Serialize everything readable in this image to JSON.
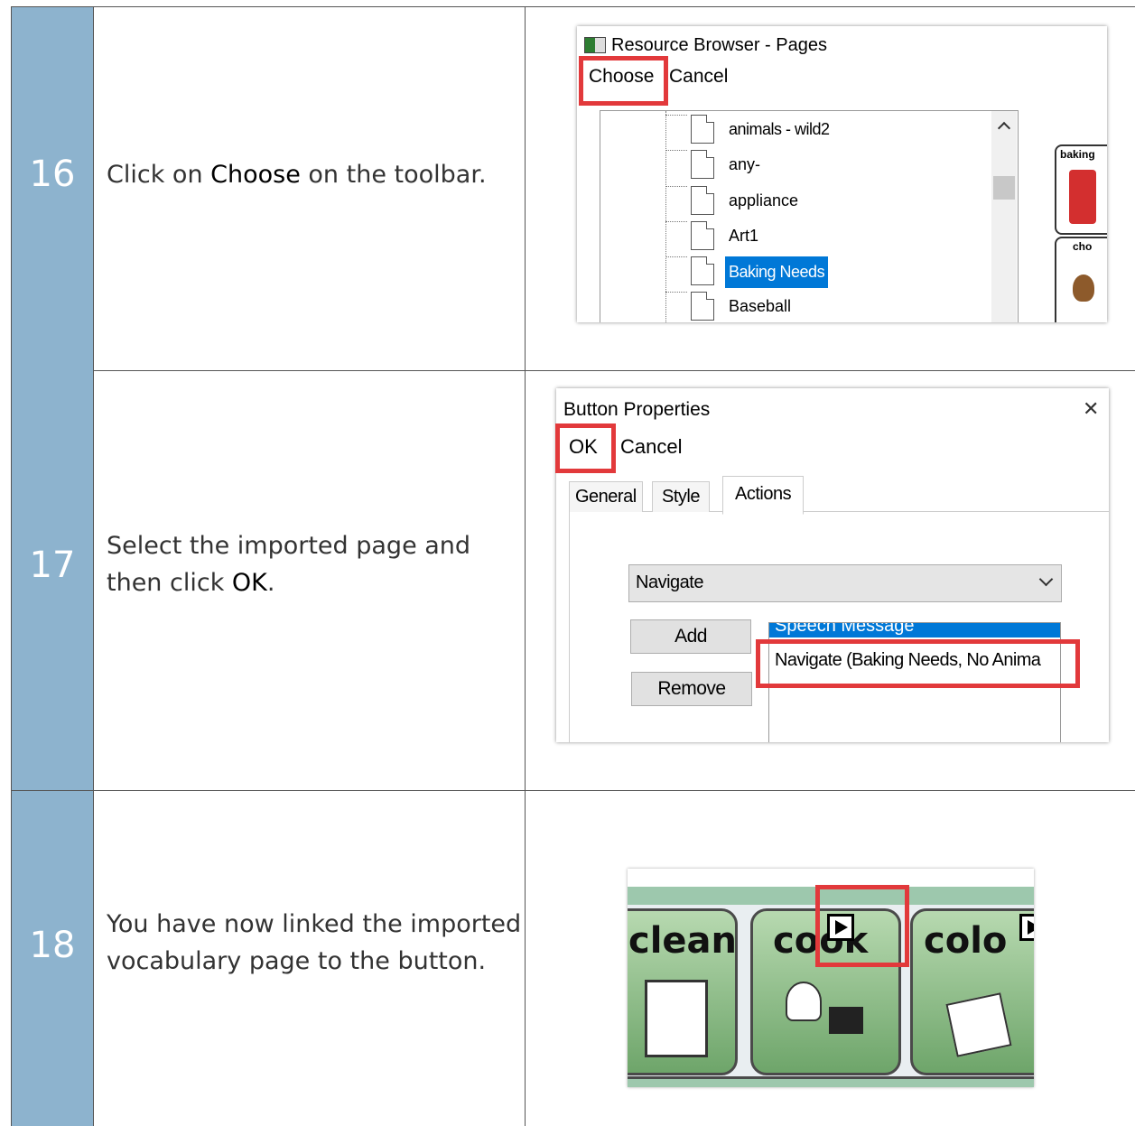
{
  "steps": [
    {
      "number": "16",
      "text_before": "Click on ",
      "text_bold": "Choose",
      "text_after": " on the toolbar."
    },
    {
      "number": "17",
      "text_before": "Select the imported page and then click ",
      "text_bold": "OK",
      "text_after": "."
    },
    {
      "number": "18",
      "text": "You have now linked the imported vocabulary page to the button."
    }
  ],
  "resource_browser": {
    "title": "Resource Browser - Pages",
    "toolbar": [
      "Choose",
      "Cancel"
    ],
    "pages": [
      "animals - wild2",
      "any-",
      "appliance",
      "Art1",
      "Baking Needs",
      "Baseball"
    ],
    "selected_page": "Baking Needs",
    "side_tiles": [
      "baking",
      "cho"
    ]
  },
  "button_properties": {
    "title": "Button Properties",
    "close_glyph": "✕",
    "toolbar": [
      "OK",
      "Cancel"
    ],
    "tabs": [
      "General",
      "Style",
      "Actions"
    ],
    "active_tab": "Actions",
    "action_select": "Navigate",
    "add_label": "Add",
    "remove_label": "Remove",
    "action_list": [
      "Speech Message",
      "Navigate (Baking Needs, No Anima"
    ]
  },
  "vocab_grid": {
    "tiles": [
      "clean",
      "cook",
      "colo"
    ]
  },
  "colors": {
    "step_number_bg": "#8db3ce",
    "highlight": "#e2393b",
    "selection": "#0078d7",
    "tile_green": "#6ea56a"
  }
}
